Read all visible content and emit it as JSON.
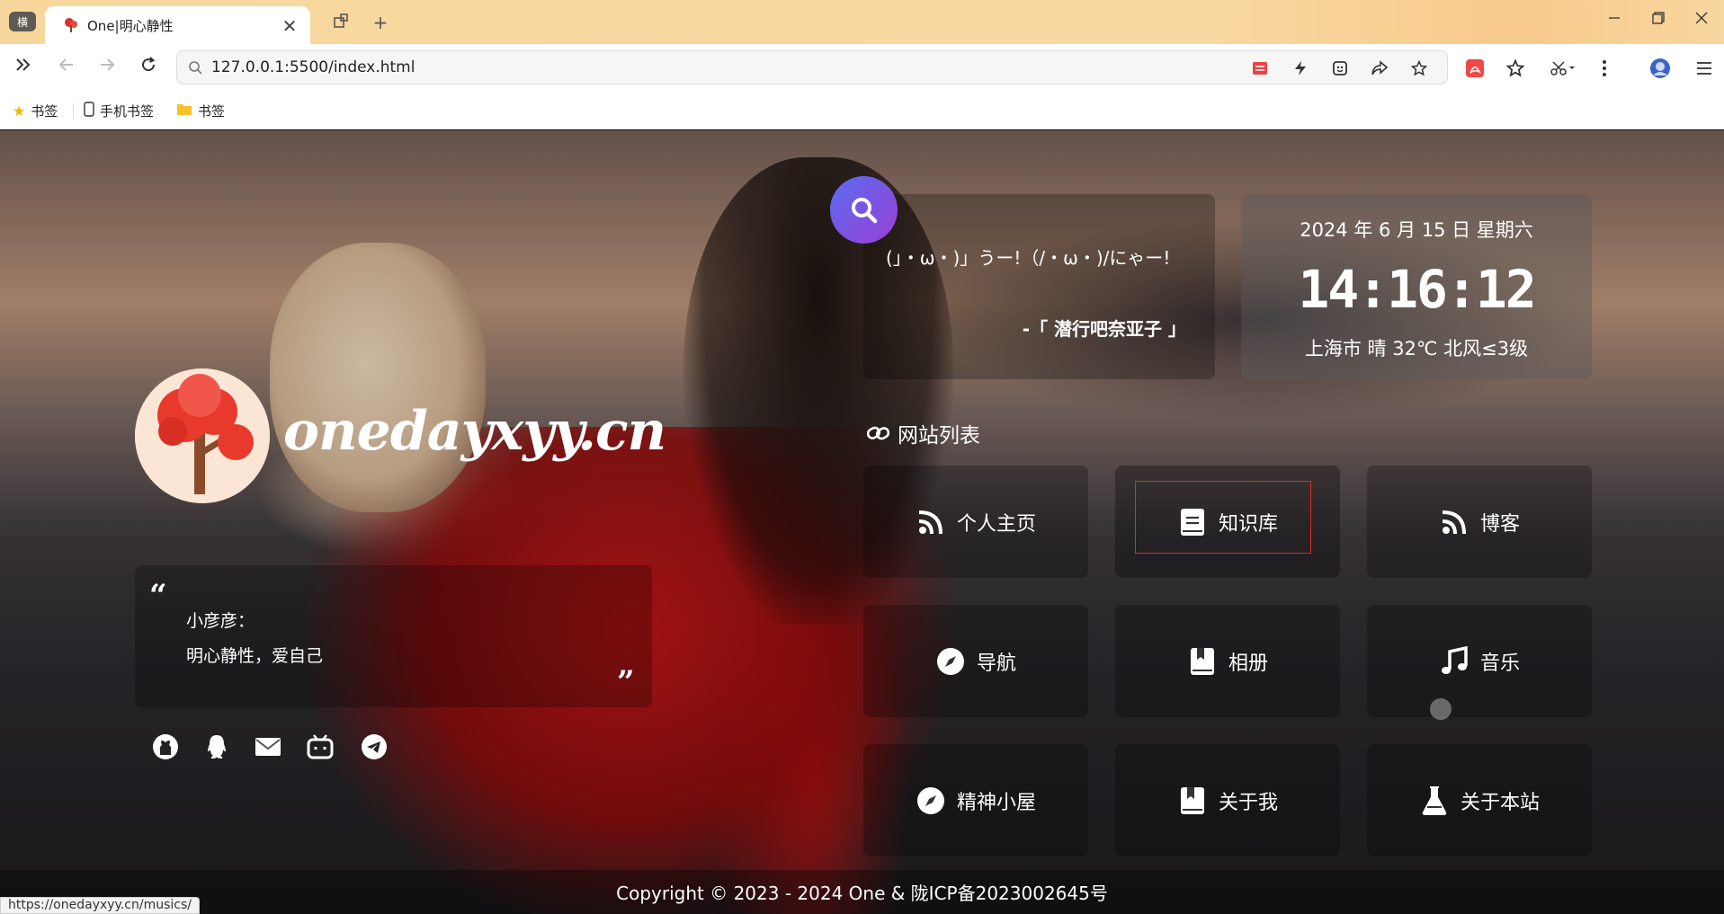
{
  "browser": {
    "tab_pill": "横",
    "tab_title": "One|明心静性",
    "close_glyph": "✕",
    "new_tab_glyph": "+",
    "url": "127.0.0.1:5500/index.html",
    "bookmarks": [
      {
        "label": "书签",
        "icon": "star-icon"
      },
      {
        "label": "手机书签",
        "icon": "phone-icon"
      },
      {
        "label": "书签",
        "icon": "folder-icon"
      }
    ],
    "status_url": "https://onedayxyy.cn/musics/"
  },
  "profile": {
    "logo_text": "onedayxyy.cn",
    "quote_name": "小彦彦：",
    "quote_text": "明心静性，爱自己",
    "social_icons": [
      "github-icon",
      "qq-icon",
      "mail-icon",
      "bilibili-icon",
      "telegram-icon"
    ]
  },
  "hitokoto": {
    "text": "(」・ω・)」うー!（/・ω・)/にゃー!",
    "source": "-「 潜行吧奈亚子 」"
  },
  "clock": {
    "date": "2024 年 6 月 15 日 星期六",
    "time": "14:16:12",
    "weather": "上海市 晴 32℃ 北风≤3级"
  },
  "sites": {
    "title": "网站列表",
    "items": [
      {
        "label": "个人主页",
        "icon": "rss-icon"
      },
      {
        "label": "知识库",
        "icon": "book-icon"
      },
      {
        "label": "博客",
        "icon": "rss-icon"
      },
      {
        "label": "导航",
        "icon": "compass-icon"
      },
      {
        "label": "相册",
        "icon": "album-icon"
      },
      {
        "label": "音乐",
        "icon": "music-icon"
      },
      {
        "label": "精神小屋",
        "icon": "compass-icon"
      },
      {
        "label": "关于我",
        "icon": "book-icon"
      },
      {
        "label": "关于本站",
        "icon": "flask-icon"
      }
    ]
  },
  "footer": {
    "text": "Copyright © 2023 - 2024 One &  陇ICP备2023002645号"
  },
  "colors": {
    "accent_start": "#5a6cf0",
    "accent_end": "#9a3fd6",
    "hover_border": "#e02a2a",
    "tabbar": "#f8d79d"
  }
}
